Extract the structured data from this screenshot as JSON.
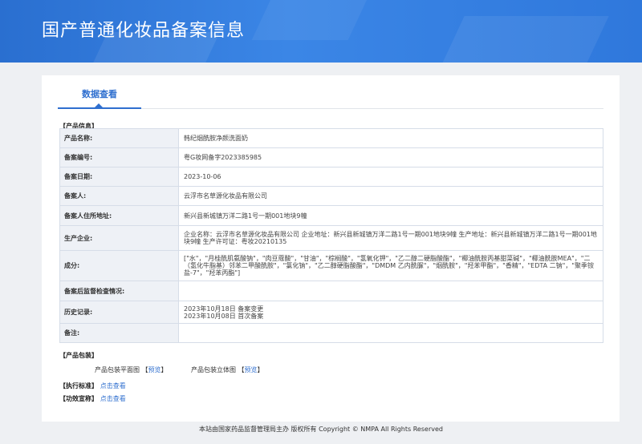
{
  "banner": {
    "title": "国产普通化妆品备案信息"
  },
  "tabs": [
    {
      "label": "数据查看"
    }
  ],
  "product_info": {
    "section_title": "【产品信息】",
    "rows": [
      {
        "label": "产品名称:",
        "value": "韩纪烟酰胺净颜洗面奶"
      },
      {
        "label": "备案编号:",
        "value": "粤G妆网备字2023385985"
      },
      {
        "label": "备案日期:",
        "value": "2023-10-06"
      },
      {
        "label": "备案人:",
        "value": "云浮市名草源化妆品有限公司"
      },
      {
        "label": "备案人住所地址:",
        "value": "新兴县新城镇万洋二路1号一期001地块9幢"
      },
      {
        "label": "生产企业:",
        "value": "企业名称：云浮市名草源化妆品有限公司 企业地址：新兴县新城镇万洋二路1号一期001地块9幢 生产地址：新兴县新城镇万洋二路1号一期001地块9幢 生产许可证：粤妆20210135"
      },
      {
        "label": "成分:",
        "value": "[\"水\"，\"月桂酰肌氨酸钠\"，\"肉豆蔻酸\"，\"甘油\"，\"棕榈酸\"，\"氢氧化钾\"，\"乙二醇二硬脂酸酯\"，\"椰油酰胺丙基甜菜碱\"，\"椰油酰胺MEA\"，\"二（氢化牛脂基）邻苯二甲酸酰胺\"，\"氯化钠\"，\"乙二醇硬脂酸酯\"，\"DMDM 乙内酰脲\"，\"烟酰胺\"，\"羟苯甲酯\"，\"香精\"，\"EDTA 二钠\"，\"聚季铵盐-7\"，\"羟苯丙酯\"]"
      },
      {
        "label": "备案后监督检查情况:",
        "value": ""
      },
      {
        "label": "历史记录:",
        "value_lines": [
          "2023年10月18日 备案变更",
          "2023年10月08日 首次备案"
        ]
      },
      {
        "label": "备注:",
        "value": ""
      }
    ]
  },
  "packaging": {
    "section_title": "【产品包装】",
    "flat_label": "产品包装平面图",
    "flat_link": "预览",
    "solid_label": "产品包装立体图",
    "solid_link": "预览",
    "bracket_open": "【",
    "bracket_close": "】"
  },
  "standard": {
    "section_title": "【执行标准】",
    "link": "点击查看"
  },
  "efficacy": {
    "section_title": "【功效宣称】",
    "link": "点击查看"
  },
  "footer": {
    "text": "本站由国家药品监督管理局主办 版权所有 Copyright © NMPA All Rights Reserved"
  },
  "colors": {
    "banner": "#3b86e6",
    "accent": "#2f6fcf",
    "label_bg": "#eef1f6",
    "page_bg": "#eef0f3"
  }
}
